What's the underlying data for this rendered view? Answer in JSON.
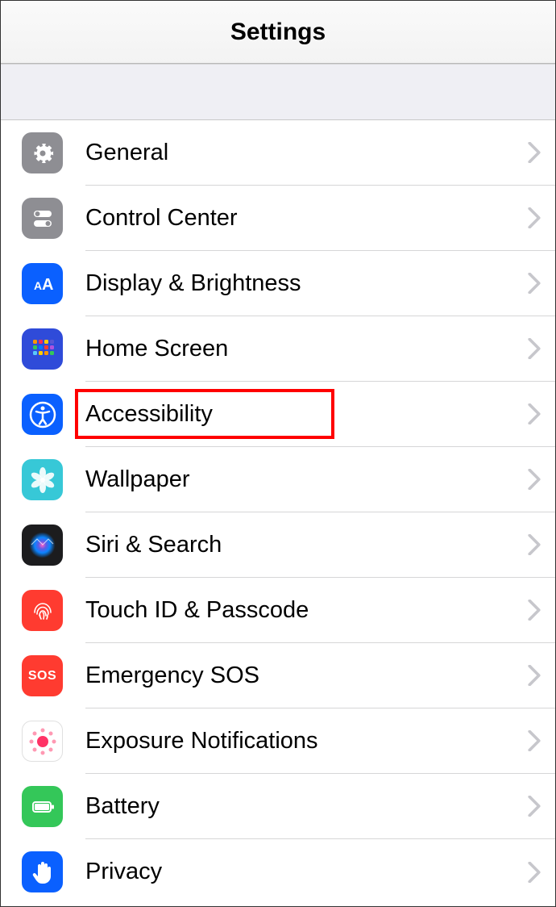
{
  "header": {
    "title": "Settings"
  },
  "rows": [
    {
      "id": "general",
      "label": "General",
      "icon": "gear-icon",
      "icon_bg": "#8E8E93"
    },
    {
      "id": "control-center",
      "label": "Control Center",
      "icon": "toggles-icon",
      "icon_bg": "#8E8E93"
    },
    {
      "id": "display-brightness",
      "label": "Display & Brightness",
      "icon": "text-size-icon",
      "icon_bg": "#0A60FF"
    },
    {
      "id": "home-screen",
      "label": "Home Screen",
      "icon": "app-grid-icon",
      "icon_bg": "#3A4AD9"
    },
    {
      "id": "accessibility",
      "label": "Accessibility",
      "icon": "accessibility-person-icon",
      "icon_bg": "#0A60FF",
      "highlighted": true
    },
    {
      "id": "wallpaper",
      "label": "Wallpaper",
      "icon": "flower-icon",
      "icon_bg": "#37C8D7"
    },
    {
      "id": "siri-search",
      "label": "Siri & Search",
      "icon": "siri-orb-icon",
      "icon_bg": "#1C1C1E"
    },
    {
      "id": "touch-id-passcode",
      "label": "Touch ID & Passcode",
      "icon": "fingerprint-icon",
      "icon_bg": "#FF3B30"
    },
    {
      "id": "emergency-sos",
      "label": "Emergency SOS",
      "icon": "sos-text-icon",
      "icon_bg": "#FF3B30",
      "icon_text": "SOS"
    },
    {
      "id": "exposure-notifications",
      "label": "Exposure Notifications",
      "icon": "exposure-dots-icon",
      "icon_bg": "#FFFFFF"
    },
    {
      "id": "battery",
      "label": "Battery",
      "icon": "battery-icon",
      "icon_bg": "#34C759"
    },
    {
      "id": "privacy",
      "label": "Privacy",
      "icon": "hand-icon",
      "icon_bg": "#0A60FF"
    }
  ]
}
